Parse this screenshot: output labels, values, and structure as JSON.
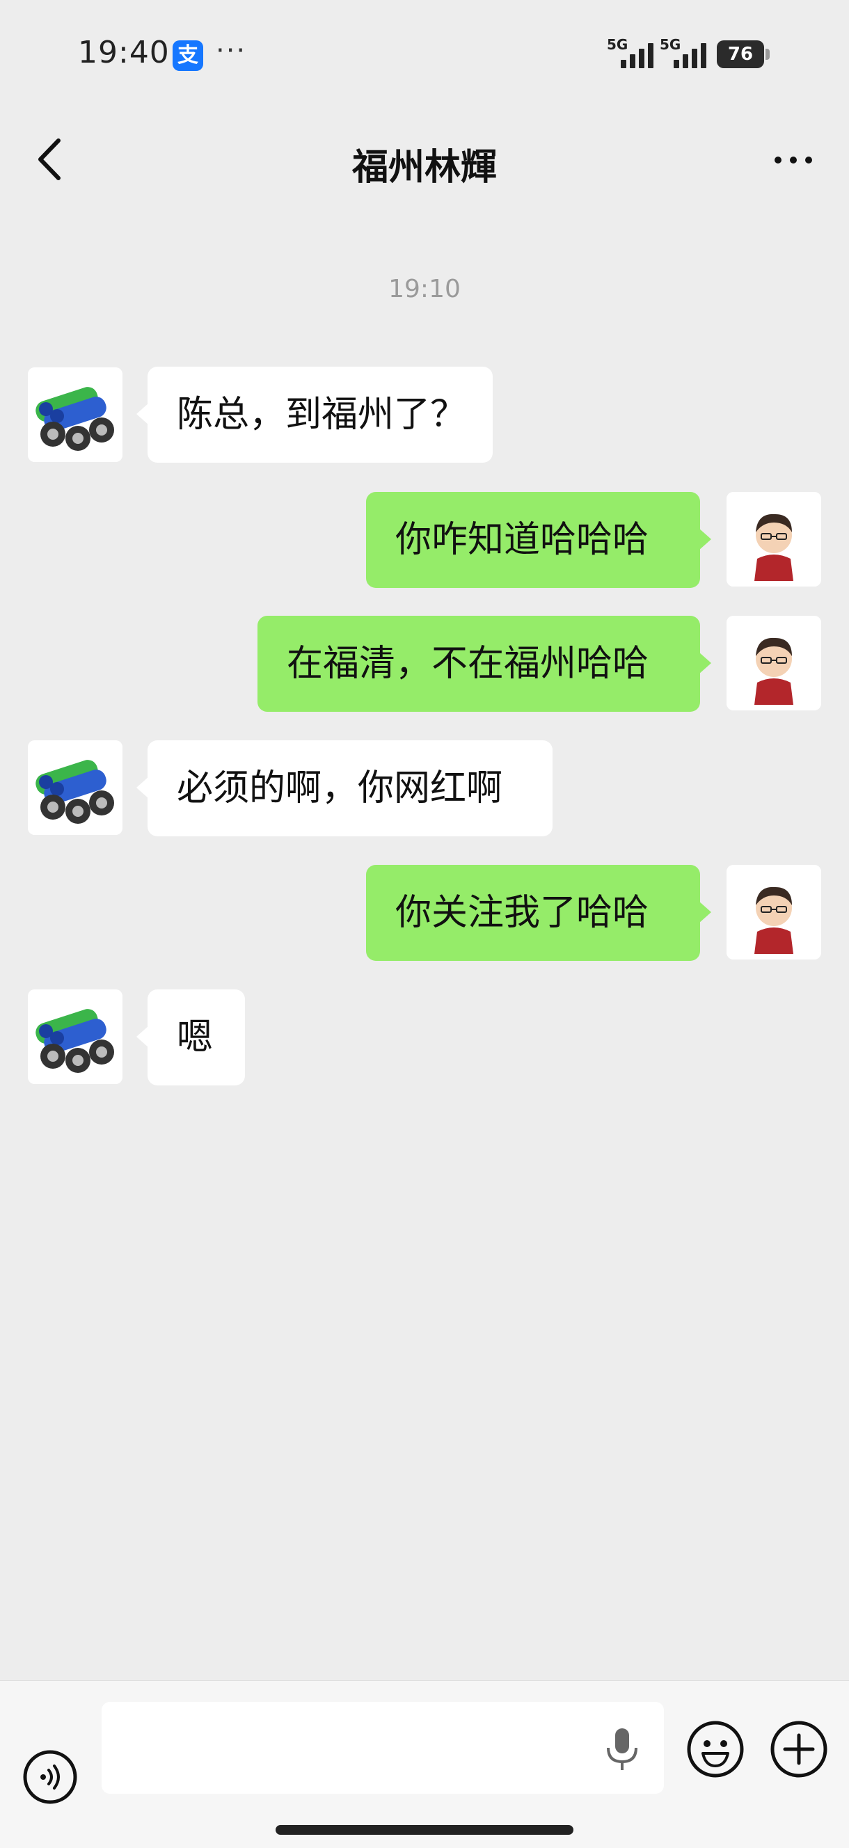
{
  "status_bar": {
    "time": "19:40",
    "app_badge": "支",
    "more_dots": "···",
    "network_1": "5G",
    "network_2": "5G",
    "battery": "76"
  },
  "header": {
    "title": "福州林輝",
    "back_icon": "chevron-left-icon",
    "more_icon": "more-horizontal-icon"
  },
  "chat": {
    "timestamp": "19:10",
    "messages": [
      {
        "side": "in",
        "text": "陈总，到福州了？",
        "avatar": "battery-avatar"
      },
      {
        "side": "out",
        "text": "你咋知道哈哈哈",
        "avatar": "cartoon-avatar"
      },
      {
        "side": "out",
        "text": "在福清，不在福州哈哈",
        "avatar": "cartoon-avatar"
      },
      {
        "side": "in",
        "text": "必须的啊，你网红啊",
        "avatar": "battery-avatar"
      },
      {
        "side": "out",
        "text": "你关注我了哈哈",
        "avatar": "cartoon-avatar"
      },
      {
        "side": "in",
        "text": "嗯",
        "avatar": "battery-avatar"
      }
    ]
  },
  "input_bar": {
    "placeholder": "",
    "voice_icon": "voice-icon",
    "mic_icon": "microphone-icon",
    "emoji_icon": "emoji-icon",
    "plus_icon": "plus-icon"
  },
  "colors": {
    "background": "#ededed",
    "incoming_bubble": "#ffffff",
    "outgoing_bubble": "#95ec69",
    "badge": "#1677ff"
  }
}
